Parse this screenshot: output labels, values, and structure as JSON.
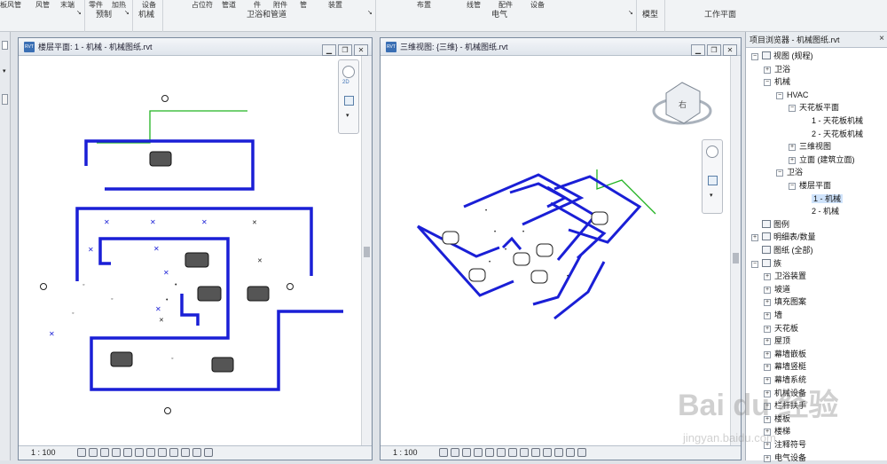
{
  "ribbon": {
    "top_row": [
      "板风管",
      "风管",
      "末端",
      "零件",
      "加热",
      "设备",
      "占位符",
      "管道",
      "件",
      "附件",
      "管",
      "装置",
      "布置",
      "线管",
      "配件",
      "设备"
    ],
    "group_labels": [
      "预制",
      "机械",
      "卫浴和管道",
      "电气",
      "模型",
      "工作平面"
    ]
  },
  "floor_plan_window": {
    "title": "楼层平面: 1 - 机械 - 机械图纸.rvt",
    "scale": "1 : 100",
    "nav_label": "2D"
  },
  "view3d_window": {
    "title": "三维视图: {三维} - 机械图纸.rvt",
    "scale": "1 : 100",
    "viewcube_face": "右"
  },
  "project_browser": {
    "title": "项目浏览器 - 机械图纸.rvt",
    "close": "×",
    "items": [
      {
        "label": "视图 (规程)",
        "toggle": "−",
        "level": 0,
        "icon": "views-icon"
      },
      {
        "label": "卫浴",
        "toggle": "+",
        "level": 1
      },
      {
        "label": "机械",
        "toggle": "−",
        "level": 1
      },
      {
        "label": "HVAC",
        "toggle": "−",
        "level": 2
      },
      {
        "label": "天花板平面",
        "toggle": "−",
        "level": 3
      },
      {
        "label": "1 - 天花板机械",
        "toggle": "",
        "level": 4
      },
      {
        "label": "2 - 天花板机械",
        "toggle": "",
        "level": 4
      },
      {
        "label": "三维视图",
        "toggle": "+",
        "level": 3
      },
      {
        "label": "立面 (建筑立面)",
        "toggle": "+",
        "level": 3
      },
      {
        "label": "卫浴",
        "toggle": "−",
        "level": 2
      },
      {
        "label": "楼层平面",
        "toggle": "−",
        "level": 3
      },
      {
        "label": "1 - 机械",
        "toggle": "",
        "level": 4,
        "selected": true
      },
      {
        "label": "2 - 机械",
        "toggle": "",
        "level": 4
      },
      {
        "label": "图例",
        "toggle": "",
        "level": 0,
        "icon": "legend-icon"
      },
      {
        "label": "明细表/数量",
        "toggle": "+",
        "level": 0,
        "icon": "schedule-icon"
      },
      {
        "label": "图纸 (全部)",
        "toggle": "",
        "level": 0,
        "icon": "sheet-icon"
      },
      {
        "label": "族",
        "toggle": "−",
        "level": 0,
        "icon": "family-icon"
      },
      {
        "label": "卫浴装置",
        "toggle": "+",
        "level": 1
      },
      {
        "label": "坡道",
        "toggle": "+",
        "level": 1
      },
      {
        "label": "填充图案",
        "toggle": "+",
        "level": 1
      },
      {
        "label": "墙",
        "toggle": "+",
        "level": 1
      },
      {
        "label": "天花板",
        "toggle": "+",
        "level": 1
      },
      {
        "label": "屋顶",
        "toggle": "+",
        "level": 1
      },
      {
        "label": "幕墙嵌板",
        "toggle": "+",
        "level": 1
      },
      {
        "label": "幕墙竖梃",
        "toggle": "+",
        "level": 1
      },
      {
        "label": "幕墙系统",
        "toggle": "+",
        "level": 1
      },
      {
        "label": "机械设备",
        "toggle": "+",
        "level": 1
      },
      {
        "label": "栏杆扶手",
        "toggle": "+",
        "level": 1
      },
      {
        "label": "楼板",
        "toggle": "+",
        "level": 1
      },
      {
        "label": "楼梯",
        "toggle": "+",
        "level": 1
      },
      {
        "label": "注释符号",
        "toggle": "+",
        "level": 1
      },
      {
        "label": "电气设备",
        "toggle": "+",
        "level": 1
      }
    ]
  },
  "watermark": {
    "brand": "Bai du 经验",
    "url": "jingyan.baidu.com"
  },
  "colors": {
    "duct": "#1a1fd6",
    "pipe_green": "#22b322",
    "equipment": "#3a3a3a"
  }
}
